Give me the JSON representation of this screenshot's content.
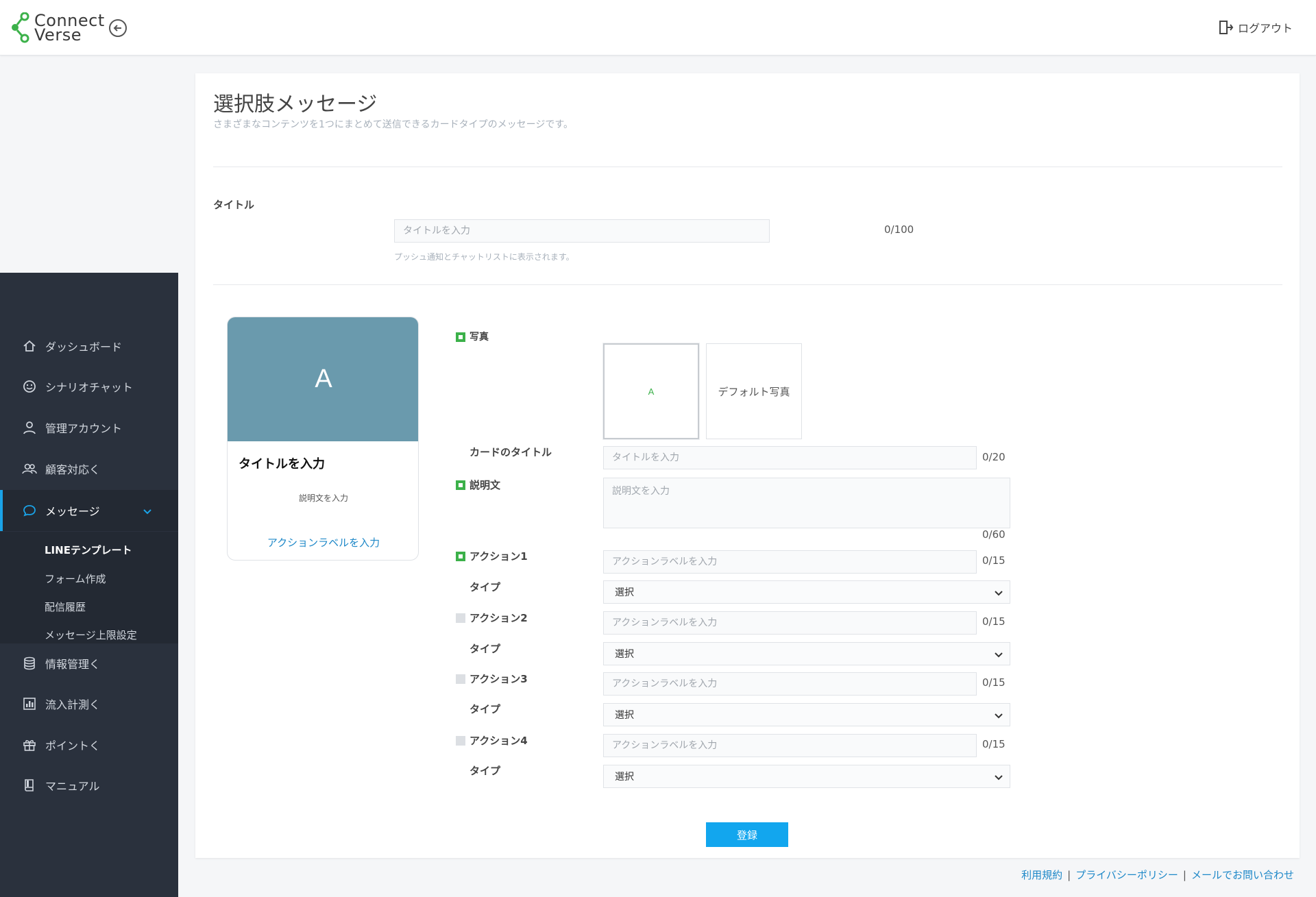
{
  "header": {
    "logo_line1": "Connect",
    "logo_line2": "Verse",
    "logout_label": "ログアウト"
  },
  "sidebar": {
    "items": [
      {
        "label": "ダッシュボード",
        "icon": "home-icon"
      },
      {
        "label": "シナリオチャット",
        "icon": "smile-icon"
      },
      {
        "label": "管理アカウント",
        "icon": "user-icon"
      },
      {
        "label": "顧客対応く",
        "icon": "users-icon"
      },
      {
        "label": "メッセージ",
        "icon": "chat-bubble-icon"
      },
      {
        "label": "情報管理く",
        "icon": "database-icon"
      },
      {
        "label": "流入計測く",
        "icon": "chart-icon"
      },
      {
        "label": "ポイントく",
        "icon": "gift-icon"
      },
      {
        "label": "マニュアル",
        "icon": "book-icon"
      }
    ],
    "submenu": [
      "LINEテンプレート",
      "フォーム作成",
      "配信履歴",
      "メッセージ上限設定"
    ]
  },
  "page": {
    "title": "選択肢メッセージ",
    "description": "さまざまなコンテンツを1つにまとめて送信できるカードタイプのメッセージです。"
  },
  "title_field": {
    "label": "タイトル",
    "placeholder": "タイトルを入力",
    "counter": "0/100",
    "hint": "プッシュ通知とチャットリストに表示されます。"
  },
  "preview": {
    "image_letter": "A",
    "title": "タイトルを入力",
    "description": "説明文を入力",
    "action": "アクションラベルを入力"
  },
  "form": {
    "photo_label": "写真",
    "photo_selected_letter": "A",
    "photo_default_label": "デフォルト写真",
    "card_title_label": "カードのタイトル",
    "card_title_placeholder": "タイトルを入力",
    "card_title_counter": "0/20",
    "desc_label": "説明文",
    "desc_placeholder": "説明文を入力",
    "desc_counter": "0/60",
    "type_label": "タイプ",
    "select_default": "選択",
    "action_placeholder": "アクションラベルを入力",
    "actions": [
      {
        "label": "アクション1",
        "counter": "0/15",
        "enabled": true
      },
      {
        "label": "アクション2",
        "counter": "0/15",
        "enabled": false
      },
      {
        "label": "アクション3",
        "counter": "0/15",
        "enabled": false
      },
      {
        "label": "アクション4",
        "counter": "0/15",
        "enabled": false
      }
    ],
    "submit_label": "登録"
  },
  "footer": {
    "links": [
      "利用規約",
      "プライバシーポリシー",
      "メールでお問い合わせ"
    ]
  },
  "colors": {
    "accent_blue": "#12a6ee",
    "check_green": "#3cb14a",
    "sidebar_bg": "#2a313d",
    "preview_image_bg": "#6a9aad"
  }
}
